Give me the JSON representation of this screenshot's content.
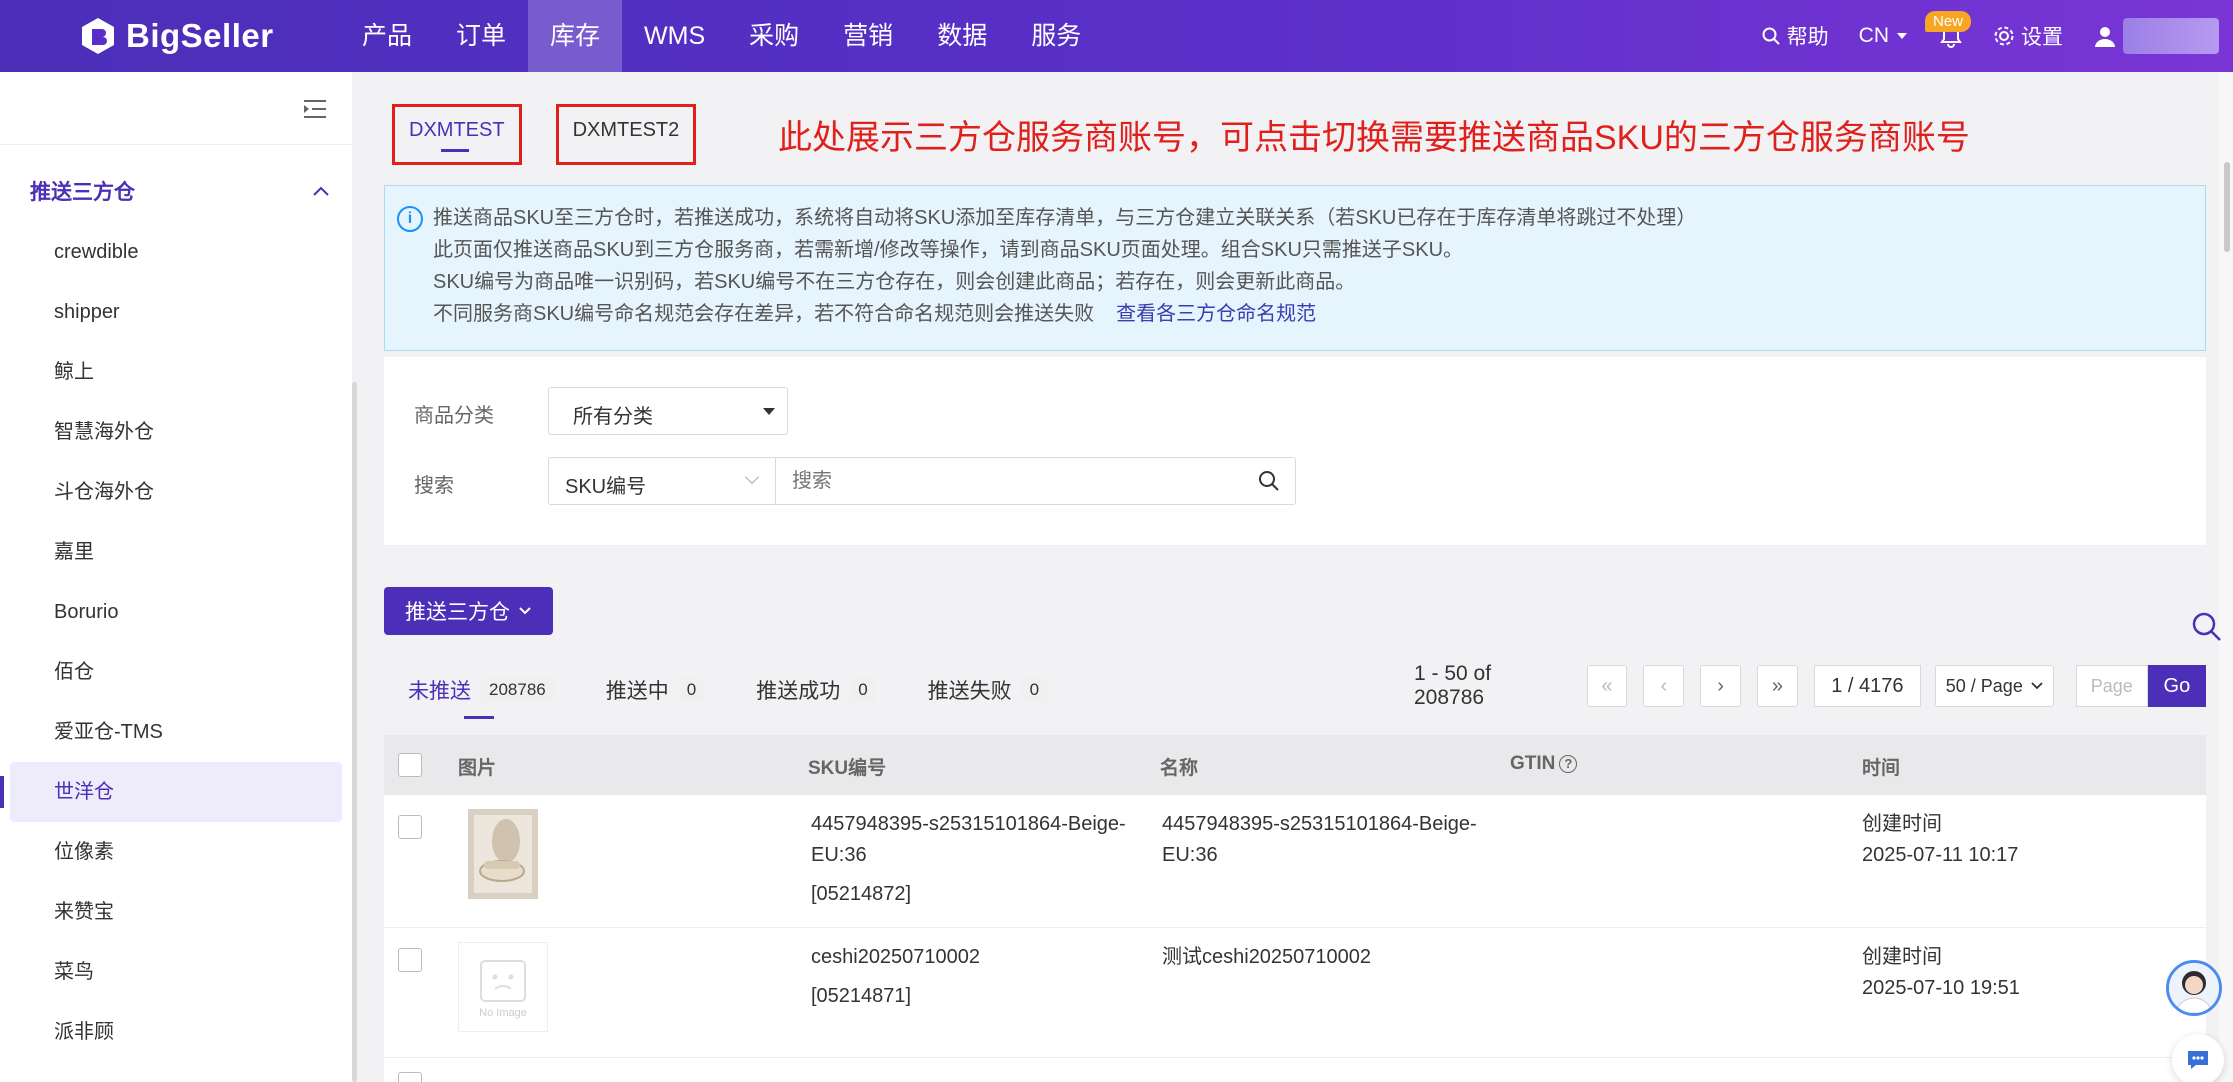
{
  "header": {
    "logo_text": "BigSeller",
    "nav": [
      {
        "label": "产品"
      },
      {
        "label": "订单"
      },
      {
        "label": "库存",
        "active": true
      },
      {
        "label": "WMS"
      },
      {
        "label": "采购"
      },
      {
        "label": "营销"
      },
      {
        "label": "数据"
      },
      {
        "label": "服务"
      }
    ],
    "help_label": "帮助",
    "lang_label": "CN",
    "new_badge": "New",
    "settings_label": "设置"
  },
  "sidebar": {
    "group_label": "推送三方仓",
    "items": [
      {
        "label": "crewdible"
      },
      {
        "label": "shipper"
      },
      {
        "label": "鲸上"
      },
      {
        "label": "智慧海外仓"
      },
      {
        "label": "斗仓海外仓"
      },
      {
        "label": "嘉里"
      },
      {
        "label": "Borurio"
      },
      {
        "label": "佰仓"
      },
      {
        "label": "爱亚仓-TMS"
      },
      {
        "label": "世洋仓",
        "active": true
      },
      {
        "label": "位像素"
      },
      {
        "label": "来赞宝"
      },
      {
        "label": "菜鸟"
      },
      {
        "label": "派非顾"
      }
    ]
  },
  "accounts": {
    "tabs": [
      {
        "label": "DXMTEST",
        "active": true
      },
      {
        "label": "DXMTEST2"
      }
    ],
    "annotation": "此处展示三方仓服务商账号，可点击切换需要推送商品SKU的三方仓服务商账号"
  },
  "info": {
    "line1": "推送商品SKU至三方仓时，若推送成功，系统将自动将SKU添加至库存清单，与三方仓建立关联关系（若SKU已存在于库存清单将跳过不处理）",
    "line2": "此页面仅推送商品SKU到三方仓服务商，若需新增/修改等操作，请到商品SKU页面处理。组合SKU只需推送子SKU。",
    "line3": "SKU编号为商品唯一识别码，若SKU编号不在三方仓存在，则会创建此商品；若存在，则会更新此商品。",
    "line4": "不同服务商SKU编号命名规范会存在差异，若不符合命名规范则会推送失败",
    "link": "查看各三方仓命名规范"
  },
  "filters": {
    "category_label": "商品分类",
    "category_value": "所有分类",
    "search_label": "搜索",
    "search_field": "SKU编号",
    "search_placeholder": "搜索"
  },
  "actions": {
    "push_button": "推送三方仓"
  },
  "status_tabs": [
    {
      "label": "未推送",
      "count": "208786",
      "active": true
    },
    {
      "label": "推送中",
      "count": "0"
    },
    {
      "label": "推送成功",
      "count": "0"
    },
    {
      "label": "推送失败",
      "count": "0"
    }
  ],
  "pagination": {
    "range": "1 - 50 of 208786",
    "page": "1 / 4176",
    "page_size": "50 / Page",
    "page_placeholder": "Page",
    "go": "Go"
  },
  "table": {
    "columns": [
      "图片",
      "SKU编号",
      "名称",
      "GTIN",
      "时间"
    ],
    "rows": [
      {
        "sku": "4457948395-s25315101864-Beige-EU:36",
        "sku_id": "[05214872]",
        "name": "4457948395-s25315101864-Beige-EU:36",
        "time_label": "创建时间",
        "time": "2025-07-11 10:17",
        "image": "product"
      },
      {
        "sku": "ceshi20250710002",
        "sku_id": "[05214871]",
        "name": "测试ceshi20250710002",
        "time_label": "创建时间",
        "time": "2025-07-10 19:51",
        "image": "no-image",
        "no_image_text": "No Image"
      }
    ]
  },
  "colors": {
    "brand": "#4b2fb8",
    "annotation": "#e0201b",
    "info_bg": "#e6f5fd"
  }
}
